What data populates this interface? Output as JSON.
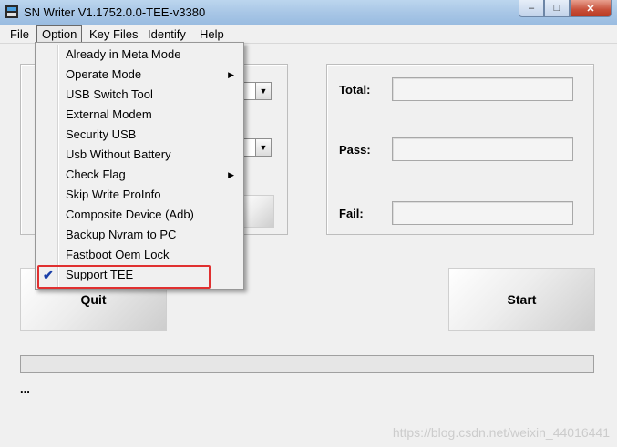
{
  "window": {
    "title": "SN Writer V1.1752.0.0-TEE-v3380",
    "min_symbol": "–",
    "max_symbol": "□",
    "close_symbol": "✕"
  },
  "menubar": {
    "items": [
      "File",
      "Option",
      "Key Files",
      "Identify",
      "Help"
    ],
    "active": "Option"
  },
  "option_menu": {
    "items": [
      {
        "label": "Already in Meta Mode",
        "submenu": false,
        "checked": false
      },
      {
        "label": "Operate Mode",
        "submenu": true,
        "checked": false
      },
      {
        "label": "USB Switch Tool",
        "submenu": false,
        "checked": false
      },
      {
        "label": "External Modem",
        "submenu": false,
        "checked": false
      },
      {
        "label": "Security USB",
        "submenu": false,
        "checked": false
      },
      {
        "label": "Usb Without Battery",
        "submenu": false,
        "checked": false
      },
      {
        "label": "Check Flag",
        "submenu": true,
        "checked": false
      },
      {
        "label": "Skip Write ProInfo",
        "submenu": false,
        "checked": false
      },
      {
        "label": "Composite Device (Adb)",
        "submenu": false,
        "checked": false
      },
      {
        "label": "Backup Nvram to PC",
        "submenu": false,
        "checked": false
      },
      {
        "label": "Fastboot Oem Lock",
        "submenu": false,
        "checked": false
      },
      {
        "label": "Support TEE",
        "submenu": false,
        "checked": true
      }
    ],
    "check_glyph": "✔",
    "submenu_glyph": "▶",
    "highlight_color": "#e03030"
  },
  "stats": {
    "total_label": "Total:",
    "pass_label": "Pass:",
    "fail_label": "Fail:",
    "total_value": "",
    "pass_value": "",
    "fail_value": ""
  },
  "buttons": {
    "quit": "Quit",
    "start": "Start"
  },
  "status_text": "...",
  "progress": 0,
  "watermark": "https://blog.csdn.net/weixin_44016441"
}
